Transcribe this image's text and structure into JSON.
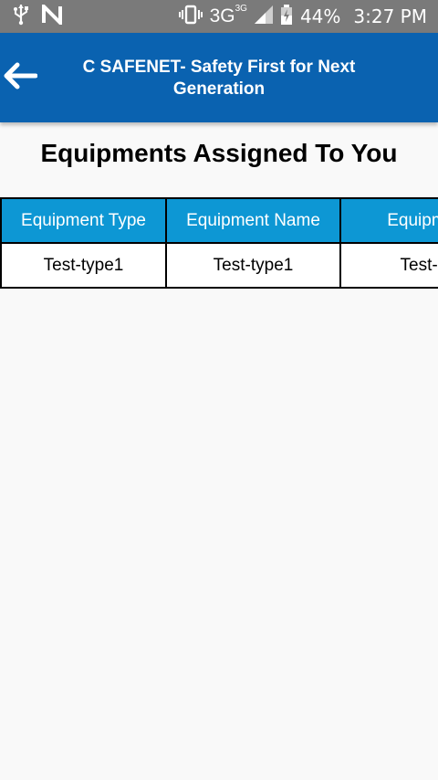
{
  "status_bar": {
    "network": "3G",
    "network_sup": "3G",
    "battery": "44%",
    "time": "3:27 PM"
  },
  "app_bar": {
    "title": "C SAFENET- Safety First for Next Generation"
  },
  "page": {
    "heading": "Equipments Assigned To You"
  },
  "table": {
    "headers": [
      "Equipment Type",
      "Equipment Name",
      "Equipmen"
    ],
    "rows": [
      [
        "Test-type1",
        "Test-type1",
        "Test-m"
      ]
    ]
  },
  "colors": {
    "app_bar": "#0a62b0",
    "table_header": "#0d97d4",
    "status_bar": "#7a7a7a",
    "background": "#f9f9f9"
  }
}
